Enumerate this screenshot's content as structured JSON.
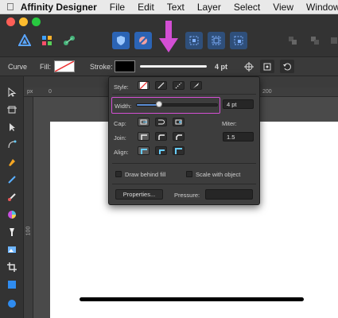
{
  "menubar": {
    "app_name": "Affinity Designer",
    "items": [
      "File",
      "Edit",
      "Text",
      "Layer",
      "Select",
      "View",
      "Window"
    ]
  },
  "context_bar": {
    "tool_name": "Curve",
    "fill_label": "Fill:",
    "stroke_label": "Stroke:",
    "stroke_width_value": "4 pt"
  },
  "rulers": {
    "unit": "px",
    "top_ticks": [
      "0",
      "200"
    ],
    "left_ticks": [
      "100"
    ]
  },
  "stroke_panel": {
    "style_label": "Style:",
    "width_label": "Width:",
    "width_value": "4 pt",
    "width_slider_fraction": 0.28,
    "cap_label": "Cap:",
    "join_label": "Join:",
    "align_label": "Align:",
    "miter_label": "Miter:",
    "miter_value": "1.5",
    "draw_behind_fill_label": "Draw behind fill",
    "scale_with_object_label": "Scale with object",
    "properties_button_label": "Properties...",
    "pressure_label": "Pressure:"
  },
  "colors": {
    "annotation_accent": "#d34fd4",
    "toolbar_icon_blue": "#3a86e0",
    "traffic_red": "#fe5f57",
    "traffic_yellow": "#febc2e",
    "traffic_green": "#28c840"
  }
}
